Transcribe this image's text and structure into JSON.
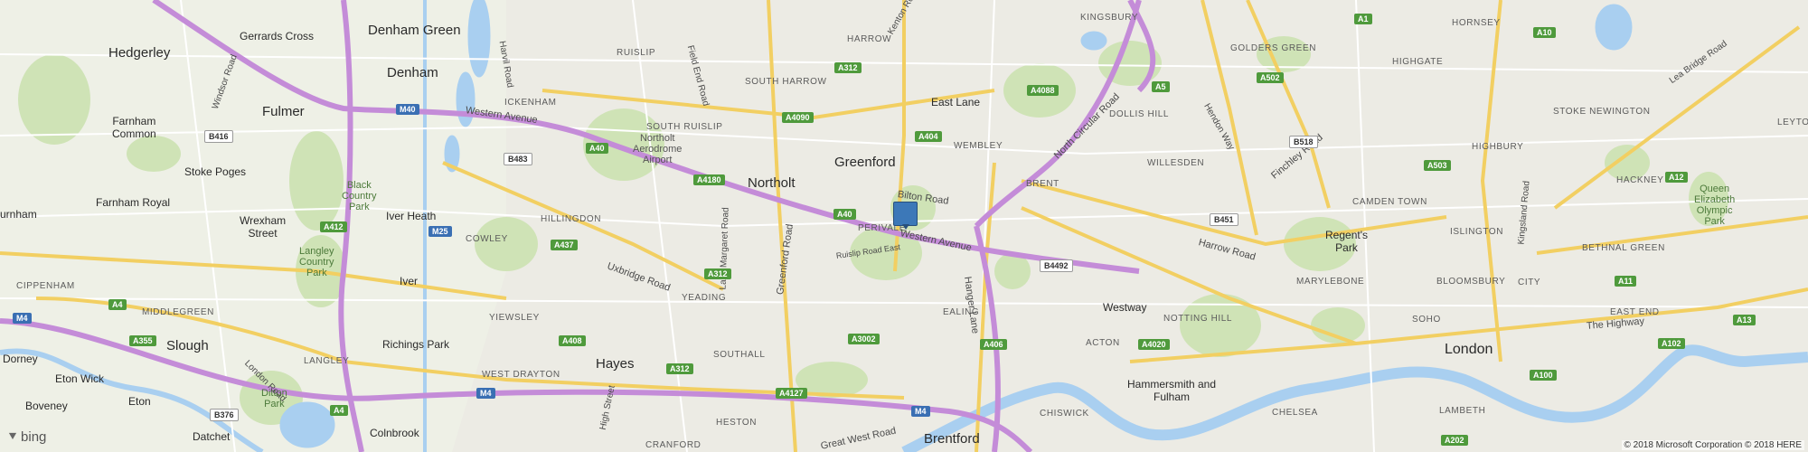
{
  "branding": {
    "label": "bing",
    "icon": "bing-logo-icon"
  },
  "copyright": "© 2018 Microsoft Corporation © 2018 HERE",
  "colors": {
    "pin": "#3c78b8",
    "motorway": "#c48cd8",
    "major_road": "#f2cf62",
    "water": "#a9cff0",
    "park": "#cfe3b6"
  },
  "places": {
    "denham_green": "Denham Green",
    "gerrards_cross": "Gerrards Cross",
    "hedgerley": "Hedgerley",
    "denham": "Denham",
    "fulmer": "Fulmer",
    "farnham_common": "Farnham\nCommon",
    "stoke_poges": "Stoke Poges",
    "farnham_royal": "Farnham Royal",
    "wrexham_street": "Wrexham\nStreet",
    "urnham": "urnham",
    "iver_heath": "Iver Heath",
    "iver": "Iver",
    "slough": "Slough",
    "richings_park": "Richings Park",
    "dorney": "Dorney",
    "eton_wick": "Eton Wick",
    "eton": "Eton",
    "boveney": "Boveney",
    "datchet": "Datchet",
    "colnbrook": "Colnbrook",
    "hayes": "Hayes",
    "northolt": "Northolt",
    "greenford": "Greenford",
    "brentford": "Brentford",
    "westway": "Westway",
    "hammersmith": "Hammersmith and\nFulham",
    "london": "London",
    "regents_park": "Regent's\nPark",
    "east_lane": "East Lane",
    "ruislip": "RUISLIP",
    "ickenham": "ICKENHAM",
    "south_harrow": "SOUTH HARROW",
    "harrow": "HARROW",
    "kingsbury": "KINGSBURY",
    "south_ruislip": "SOUTH RUISLIP",
    "northolt_aerodrome": "Northolt\nAerodrome\nAirport",
    "hillingdon": "HILLINGDON",
    "cowley": "COWLEY",
    "yeading": "YEADING",
    "perivale": "PERIVALE",
    "ealing": "EALING",
    "acton": "ACTON",
    "southall": "SOUTHALL",
    "west_drayton": "WEST DRAYTON",
    "langley": "LANGLEY",
    "yiewsley": "YIEWSLEY",
    "middlegreen": "MIDDLEGREEN",
    "cippenham": "CIPPENHAM",
    "heston": "HESTON",
    "cranford": "CRANFORD",
    "chiswick": "CHISWICK",
    "wembley": "WEMBLEY",
    "brent": "BRENT",
    "willesden": "WILLESDEN",
    "dollis_hill": "DOLLIS HILL",
    "golders_green": "GOLDERS GREEN",
    "hornsey": "HORNSEY",
    "highgate": "HIGHGATE",
    "stoke_newington": "STOKE NEWINGTON",
    "highbury": "HIGHBURY",
    "hackney": "HACKNEY",
    "camden_town": "CAMDEN TOWN",
    "islington": "ISLINGTON",
    "marylebone": "MARYLEBONE",
    "bloomsbury": "BLOOMSBURY",
    "city": "CITY",
    "soho": "SOHO",
    "notting_hill": "NOTTING HILL",
    "east_end": "EAST END",
    "bethnal_green": "BETHNAL GREEN",
    "lambeth": "LAMBETH",
    "chelsea": "CHELSEA",
    "leyton": "LEYTON",
    "black_country_park": "Black\nCountry\nPark",
    "langley_country_park": "Langley\nCountry\nPark",
    "ditton_park": "Ditton\nPark",
    "queen_elizabeth": "Queen\nElizabeth\nOlympic\nPark"
  },
  "roads": {
    "western_avenue_w": "Western Avenue",
    "western_avenue_c": "Western Avenue",
    "bilton_road": "Bilton Road",
    "uxbridge_road": "Uxbridge Road",
    "ruislip_road_east": "Ruislip Road East",
    "hanger_lane": "Hanger Lane",
    "greenford_road": "Greenford Road",
    "lady_margaret_road": "Lady Margaret Road",
    "kenton_road": "Kenton Road",
    "field_end_road": "Field End Road",
    "harvil_road": "Harvil Road",
    "windsor_road": "Windsor Road",
    "london_road": "London Road",
    "north_circular": "North Circular Road",
    "harrow_road": "Harrow Road",
    "finchley_road": "Finchley Road",
    "hendon_way": "Hendon Way",
    "great_west_road": "Great West Road",
    "the_highway": "The Highway",
    "kingsland_road": "Kingsland Road",
    "lea_bridge_road": "Lea Bridge Road",
    "high_street": "High Street"
  },
  "shields": {
    "m40": "M40",
    "m25": "M25",
    "m4a": "M4",
    "m4b": "M4",
    "m4c": "M4",
    "a40a": "A40",
    "a40b": "A40",
    "a4180": "A4180",
    "a4090": "A4090",
    "a312a": "A312",
    "a312b": "A312",
    "a312c": "A312",
    "a437": "A437",
    "a408": "A408",
    "a412": "A412",
    "a355": "A355",
    "a4a": "A4",
    "a4b": "A4",
    "a406": "A406",
    "a4020": "A4020",
    "a3002": "A3002",
    "a4127": "A4127",
    "a404": "A404",
    "a4088": "A4088",
    "a5a": "A5",
    "a502": "A502",
    "a1": "A1",
    "a10": "A10",
    "a503": "A503",
    "a12": "A12",
    "a11": "A11",
    "a13": "A13",
    "a100": "A100",
    "a102": "A102",
    "a202": "A202",
    "b416": "B416",
    "b483": "B483",
    "b4492": "B4492",
    "b451": "B451",
    "b518": "B518",
    "b376": "B376"
  }
}
